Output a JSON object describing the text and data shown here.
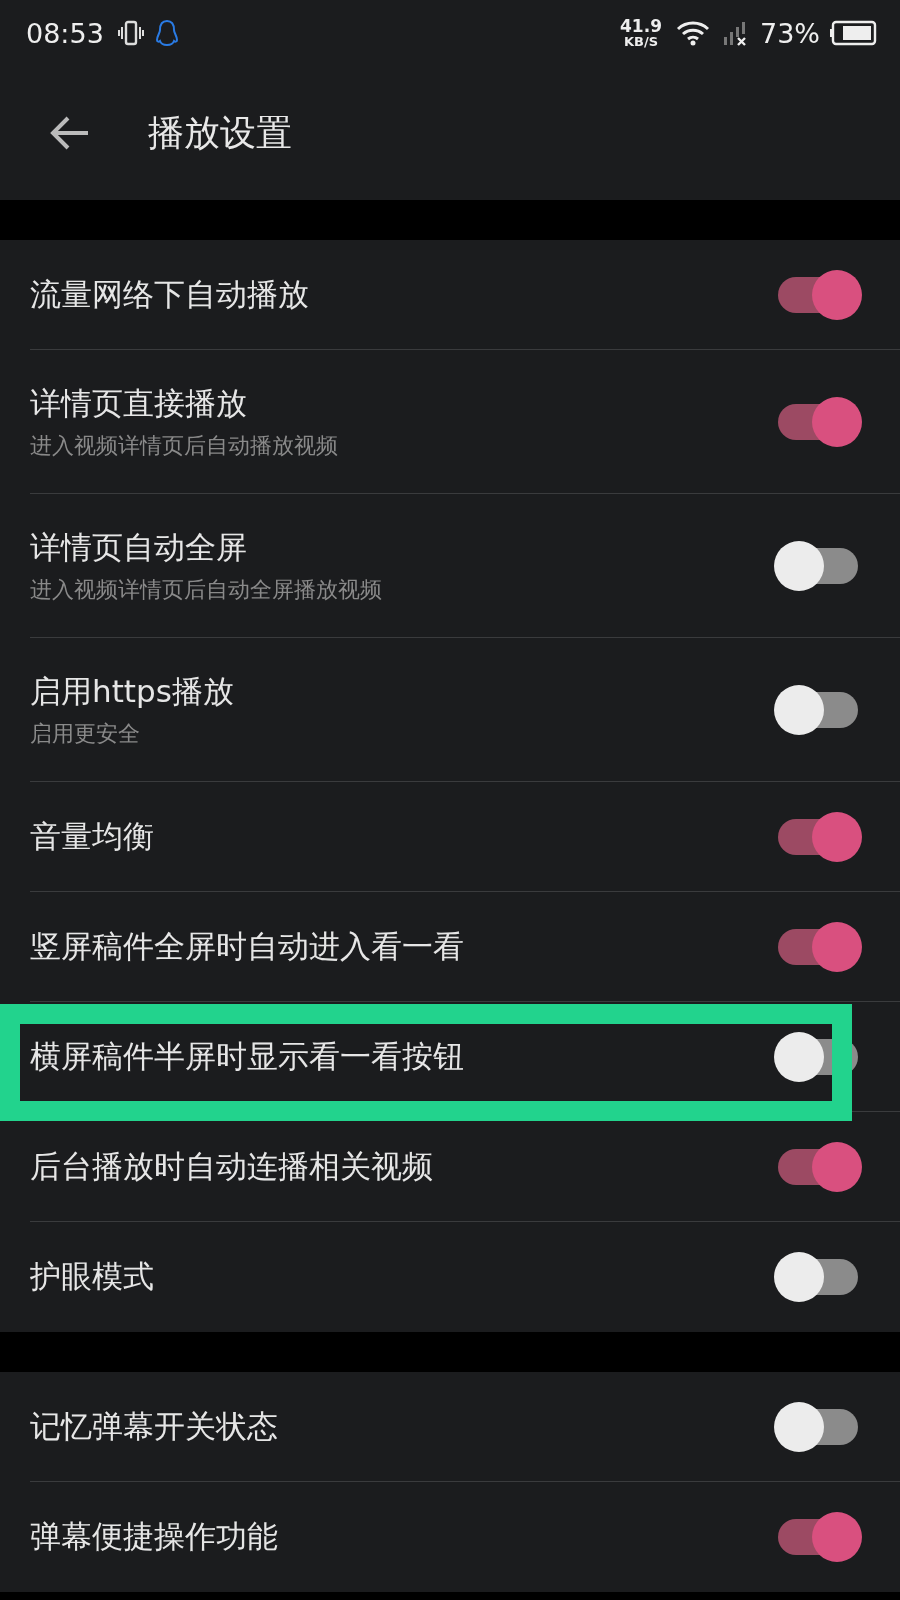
{
  "status_bar": {
    "time": "08:53",
    "speed_value": "41.9",
    "speed_unit": "KB/S",
    "battery": "73%"
  },
  "header": {
    "title": "播放设置"
  },
  "sections": [
    {
      "items": [
        {
          "title": "流量网络下自动播放",
          "on": true,
          "highlighted": false
        },
        {
          "title": "详情页直接播放",
          "subtitle": "进入视频详情页后自动播放视频",
          "on": true,
          "highlighted": false
        },
        {
          "title": "详情页自动全屏",
          "subtitle": "进入视频详情页后自动全屏播放视频",
          "on": false,
          "highlighted": false
        },
        {
          "title": "启用https播放",
          "subtitle": "启用更安全",
          "on": false,
          "highlighted": false
        },
        {
          "title": "音量均衡",
          "on": true,
          "highlighted": false
        },
        {
          "title": "竖屏稿件全屏时自动进入看一看",
          "on": true,
          "highlighted": false
        },
        {
          "title": "横屏稿件半屏时显示看一看按钮",
          "on": false,
          "highlighted": true
        },
        {
          "title": "后台播放时自动连播相关视频",
          "on": true,
          "highlighted": false
        },
        {
          "title": "护眼模式",
          "on": false,
          "highlighted": false
        }
      ]
    },
    {
      "items": [
        {
          "title": "记忆弹幕开关状态",
          "on": false,
          "highlighted": false
        },
        {
          "title": "弹幕便捷操作功能",
          "on": true,
          "highlighted": false
        }
      ]
    }
  ]
}
